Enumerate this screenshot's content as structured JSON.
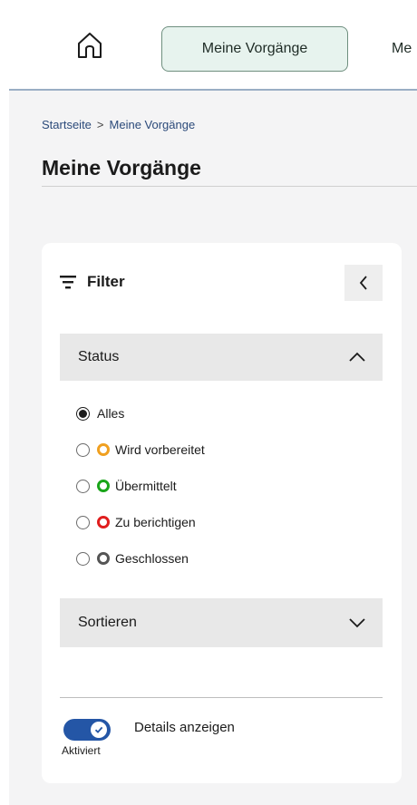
{
  "nav": {
    "home_icon": "home-icon",
    "active_label": "Meine Vorgänge",
    "next_label_partial": "Me"
  },
  "breadcrumb": {
    "home": "Startseite",
    "separator": ">",
    "current": "Meine Vorgänge"
  },
  "page": {
    "title": "Meine Vorgänge"
  },
  "filter": {
    "title": "Filter",
    "filter_icon": "filter-icon",
    "collapse_icon": "chevron-left-icon",
    "status": {
      "label": "Status",
      "expanded": true,
      "options": [
        {
          "label": "Alles",
          "checked": true,
          "ring_color": null
        },
        {
          "label": "Wird vorbereitet",
          "checked": false,
          "ring_color": "#f0a020"
        },
        {
          "label": "Übermittelt",
          "checked": false,
          "ring_color": "#1aa51a"
        },
        {
          "label": "Zu berichtigen",
          "checked": false,
          "ring_color": "#e01e1e"
        },
        {
          "label": "Geschlossen",
          "checked": false,
          "ring_color": "#555555"
        }
      ]
    },
    "sort": {
      "label": "Sortieren",
      "expanded": false
    }
  },
  "details_toggle": {
    "label": "Details anzeigen",
    "state_label": "Aktiviert",
    "on": true
  },
  "colors": {
    "accent": "#2456a6",
    "nav_active_bg": "#e7f3ee",
    "nav_active_border": "#6f8f7f"
  }
}
